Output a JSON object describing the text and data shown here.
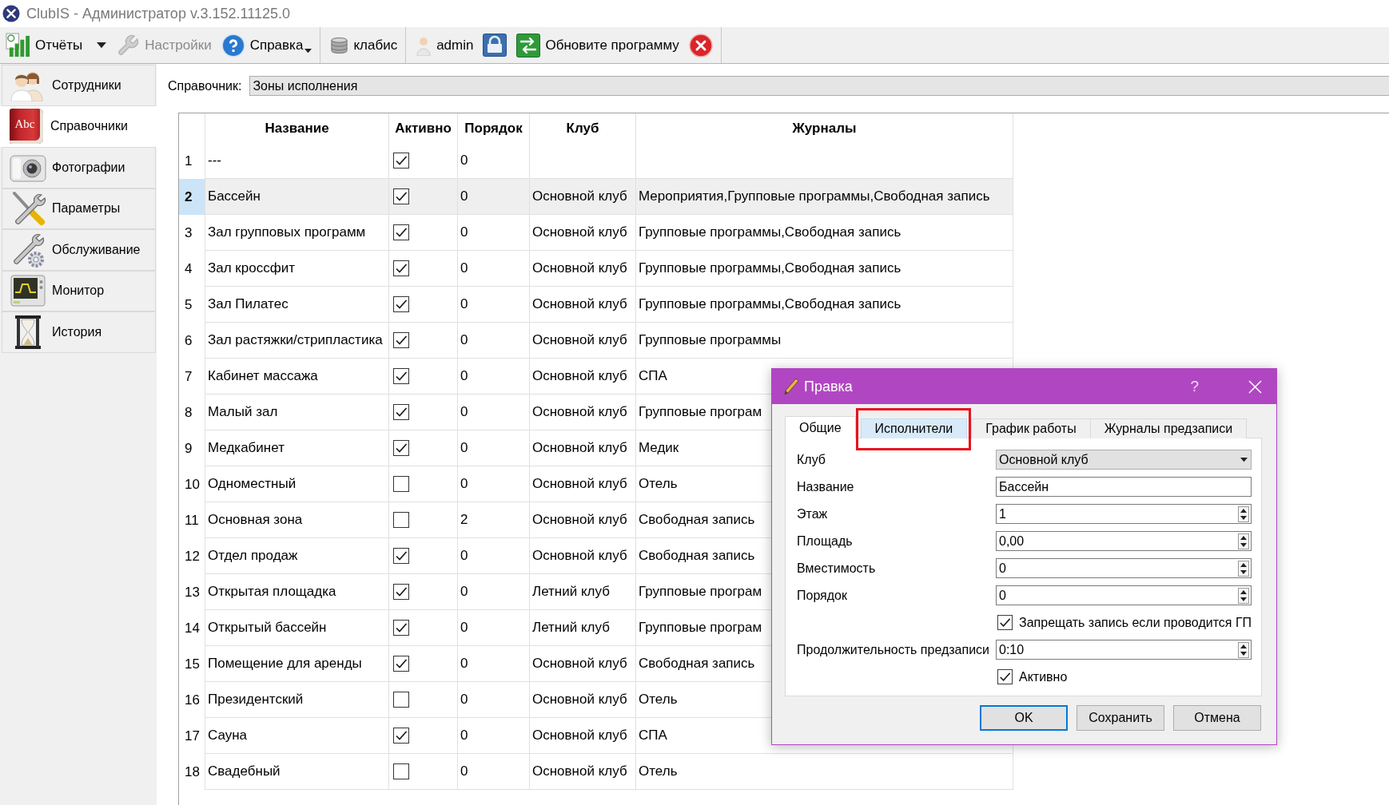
{
  "window": {
    "title": "ClubIS - Администратор v.3.152.11125.0"
  },
  "toolbar": {
    "groups": [
      [
        {
          "kind": "reports",
          "label": "Отчёты",
          "disabled": false,
          "menu": true
        },
        {
          "kind": "settings",
          "label": "Настройки",
          "disabled": true,
          "menu": false
        },
        {
          "kind": "help",
          "label": "Справка",
          "disabled": false,
          "menu": true
        }
      ],
      [
        {
          "kind": "database",
          "label": "клабис",
          "disabled": false,
          "menu": false
        }
      ],
      [
        {
          "kind": "user",
          "label": "admin",
          "disabled": false,
          "menu": false
        },
        {
          "kind": "lock",
          "disabled": false,
          "menu": false
        },
        {
          "kind": "update",
          "label": "Обновите программу",
          "disabled": false,
          "menu": false
        },
        {
          "kind": "dismiss",
          "disabled": false,
          "menu": false
        }
      ]
    ]
  },
  "sidebar": {
    "items": [
      {
        "label": "Сотрудники",
        "selected": false
      },
      {
        "label": "Справочники",
        "selected": true,
        "icon_text": "Abc"
      },
      {
        "label": "Фотографии",
        "selected": false
      },
      {
        "label": "Параметры",
        "selected": false
      },
      {
        "label": "Обслуживание",
        "selected": false
      },
      {
        "label": "Монитор",
        "selected": false
      },
      {
        "label": "История",
        "selected": false
      }
    ]
  },
  "directory": {
    "label": "Справочник:",
    "value": "Зоны исполнения"
  },
  "table": {
    "columns": [
      "Название",
      "Активно",
      "Порядок",
      "Клуб",
      "Журналы"
    ],
    "rows": [
      {
        "number": "1",
        "name": "---",
        "active": true,
        "order": "0",
        "selected": false
      },
      {
        "number": "2",
        "name": "Бассейн",
        "active": true,
        "order": "0",
        "club": "Основной клуб",
        "journals": "Мероприятия,Групповые программы,Свободная запись",
        "selected": true
      },
      {
        "number": "3",
        "name": "Зал групповых программ",
        "active": true,
        "order": "0",
        "club": "Основной клуб",
        "journals": "Групповые программы,Свободная запись",
        "selected": false
      },
      {
        "number": "4",
        "name": "Зал кроссфит",
        "active": true,
        "order": "0",
        "club": "Основной клуб",
        "journals": "Групповые программы,Свободная запись",
        "selected": false
      },
      {
        "number": "5",
        "name": "Зал Пилатес",
        "active": true,
        "order": "0",
        "club": "Основной клуб",
        "journals": "Групповые программы,Свободная запись",
        "selected": false
      },
      {
        "number": "6",
        "name": "Зал растяжки/стрипластика",
        "active": true,
        "order": "0",
        "club": "Основной клуб",
        "journals": "Групповые программы",
        "selected": false
      },
      {
        "number": "7",
        "name": "Кабинет массажа",
        "active": true,
        "order": "0",
        "club": "Основной клуб",
        "journals": "СПА",
        "selected": false
      },
      {
        "number": "8",
        "name": "Малый зал",
        "active": true,
        "order": "0",
        "club": "Основной клуб",
        "journals": "Групповые програм",
        "selected": false
      },
      {
        "number": "9",
        "name": "Медкабинет",
        "active": true,
        "order": "0",
        "club": "Основной клуб",
        "journals": "Медик",
        "selected": false
      },
      {
        "number": "10",
        "name": "Одноместный",
        "active": false,
        "order": "0",
        "club": "Основной клуб",
        "journals": "Отель",
        "selected": false
      },
      {
        "number": "11",
        "name": "Основная зона",
        "active": false,
        "order": "2",
        "club": "Основной клуб",
        "journals": "Свободная запись",
        "selected": false
      },
      {
        "number": "12",
        "name": "Отдел продаж",
        "active": true,
        "order": "0",
        "club": "Основной клуб",
        "journals": "Свободная запись",
        "selected": false
      },
      {
        "number": "13",
        "name": "Открытая площадка",
        "active": true,
        "order": "0",
        "club": "Летний клуб",
        "journals": "Групповые програм",
        "selected": false
      },
      {
        "number": "14",
        "name": "Открытый бассейн",
        "active": true,
        "order": "0",
        "club": "Летний клуб",
        "journals": "Групповые програм",
        "selected": false
      },
      {
        "number": "15",
        "name": "Помещение для аренды",
        "active": true,
        "order": "0",
        "club": "Основной клуб",
        "journals": "Свободная запись",
        "selected": false
      },
      {
        "number": "16",
        "name": "Президентский",
        "active": false,
        "order": "0",
        "club": "Основной клуб",
        "journals": "Отель",
        "selected": false
      },
      {
        "number": "17",
        "name": "Сауна",
        "active": true,
        "order": "0",
        "club": "Основной клуб",
        "journals": "СПА",
        "selected": false
      },
      {
        "number": "18",
        "name": "Свадебный",
        "active": false,
        "order": "0",
        "club": "Основной клуб",
        "journals": "Отель",
        "selected": false
      }
    ]
  },
  "dialog": {
    "title": "Правка",
    "help_button": "?",
    "tabs": [
      {
        "label": "Общие",
        "selected": true,
        "highlighted": false
      },
      {
        "label": "Исполнители",
        "selected": false,
        "highlighted": true
      },
      {
        "label": "График работы",
        "selected": false,
        "highlighted": false
      },
      {
        "label": "Журналы предзаписи",
        "selected": false,
        "highlighted": false
      }
    ],
    "fields": [
      {
        "kind": "combo",
        "label": "Клуб",
        "value": "Основной клуб"
      },
      {
        "kind": "text",
        "label": "Название",
        "value": "Бассейн"
      },
      {
        "kind": "spin",
        "label": "Этаж",
        "value": "1"
      },
      {
        "kind": "spin",
        "label": "Площадь",
        "value": "0,00"
      },
      {
        "kind": "spin",
        "label": "Вместимость",
        "value": "0"
      },
      {
        "kind": "spin",
        "label": "Порядок",
        "value": "0"
      },
      {
        "kind": "checkbox",
        "label": "Запрещать запись если проводится ГП",
        "checked": true
      },
      {
        "kind": "spin",
        "label": "Продолжительность предзаписи",
        "value": "0:10"
      },
      {
        "kind": "checkbox",
        "label": "Активно",
        "checked": true
      }
    ],
    "buttons": [
      {
        "label": "OK",
        "default": true
      },
      {
        "label": "Сохранить",
        "default": false
      },
      {
        "label": "Отмена",
        "default": false
      }
    ]
  }
}
